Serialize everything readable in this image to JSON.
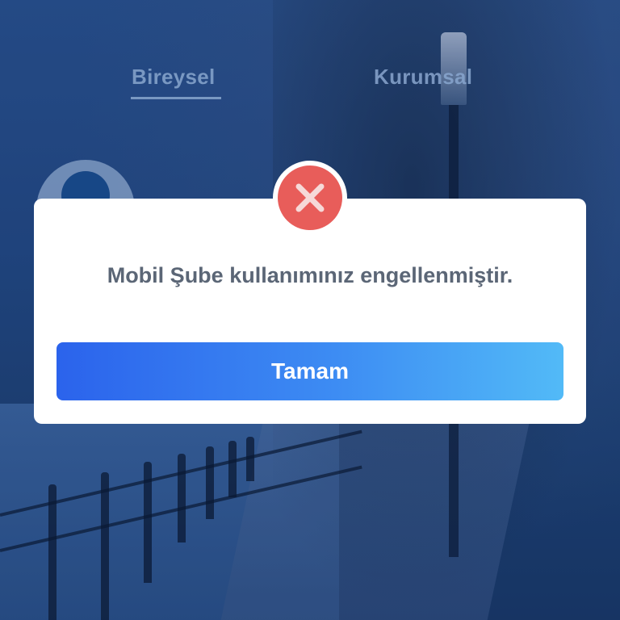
{
  "tabs": [
    {
      "label": "Bireysel",
      "active": true
    },
    {
      "label": "Kurumsal",
      "active": false
    }
  ],
  "dialog": {
    "icon": "error-x-icon",
    "message": "Mobil Şube kullanımınız engellenmiştir.",
    "ok_label": "Tamam"
  },
  "colors": {
    "error_red": "#e85d5a",
    "button_gradient_start": "#2b63ec",
    "button_gradient_end": "#52baf7",
    "message_text": "#5b6676"
  }
}
